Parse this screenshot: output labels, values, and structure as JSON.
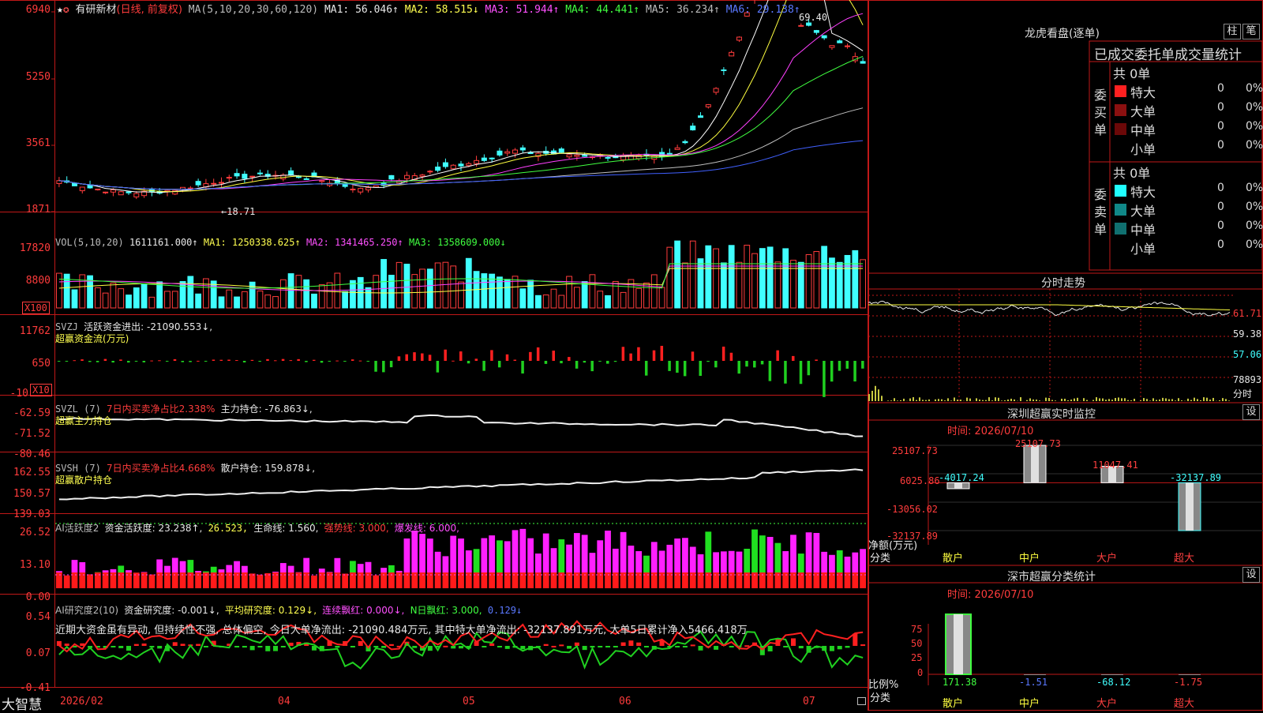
{
  "kline": {
    "title": "有研新材",
    "mode": "(日线, 前复权)",
    "ma_prefix": "MA(5,10,20,30,60,120)",
    "ma1": "MA1: 56.046↑",
    "ma2": "MA2: 58.515↓",
    "ma3": "MA3: 51.944↑",
    "ma4": "MA4: 44.441↑",
    "ma5": "MA5: 36.234↑",
    "ma6": "MA6: 29.138↑",
    "yaxis": [
      "6940",
      "5250",
      "3561",
      "1871"
    ],
    "high_label": "69.40",
    "low_label": "←18.71"
  },
  "vol": {
    "header": "VOL(5,10,20)",
    "value": "1611161.000↑",
    "ma1": "MA1: 1250338.625↑",
    "ma2": "MA2: 1341465.250↑",
    "ma3": "MA3: 1358609.000↓",
    "yaxis": [
      "17820",
      "8800"
    ],
    "unit": "X100"
  },
  "svzj": {
    "header": "SVZJ",
    "label": "活跃资金进出: -21090.553↓,",
    "sub": "超赢资金流(万元)",
    "yaxis": [
      "11762",
      "650",
      "-10"
    ],
    "unit": "X10"
  },
  "svzl": {
    "header": "SVZL (7)",
    "label1": "7日内买卖净占比2.338%",
    "label2": "主力持仓: -76.863↓,",
    "sub": "超赢主力持仓",
    "yaxis": [
      "-62.59",
      "-71.52",
      "-80.46"
    ]
  },
  "svsh": {
    "header": "SVSH (7)",
    "label1": "7日内买卖净占比4.668%",
    "label2": "散户持仓: 159.878↓,",
    "sub": "超赢散户持仓",
    "yaxis": [
      "162.55",
      "150.57",
      "139.03"
    ]
  },
  "ai1": {
    "header": "AI活跃度2",
    "l1": "资金活跃度: 23.238↑,",
    "l2": "26.523,",
    "l3": "生命线: 1.560,",
    "l4": "强势线: 3.000,",
    "l5": "爆发线: 6.000,",
    "yaxis": [
      "26.52",
      "13.10",
      "0.00"
    ]
  },
  "ai2": {
    "header": "AI研究度2(10)",
    "l1": "资金研究度: -0.001↓,",
    "l2": "平均研究度: 0.129↓,",
    "l3": "连续飘红: 0.000↓,",
    "l4": "N日飘红: 3.000,",
    "l5": "0.129↓",
    "note": "近期大资金虽有异动, 但持续性不强, 总体偏空, 今日大单净流出: -21090.484万元, 其中特大单净流出: -32137.891万元, 大单5日累计净入5466.418万",
    "yaxis": [
      "0.54",
      "0.07",
      "-0.41"
    ]
  },
  "xaxis": {
    "brand": "大智慧",
    "labels": [
      "2026/02",
      "04",
      "05",
      "06",
      "07"
    ]
  },
  "dragon": {
    "title": "龙虎看盘(逐单)",
    "btn1": "柱",
    "btn2": "笔",
    "subtitle": "已成交委托单成交量统计",
    "buy_label": "委买单",
    "sell_label": "委卖单",
    "buy_total": "共 0单",
    "sell_total": "共 0单",
    "buy_rows": [
      {
        "name": "特大",
        "n": "0",
        "p": "0%",
        "color": "#ff2020"
      },
      {
        "name": "大单",
        "n": "0",
        "p": "0%",
        "color": "#8b1010"
      },
      {
        "name": "中单",
        "n": "0",
        "p": "0%",
        "color": "#6b0808"
      },
      {
        "name": "小单",
        "n": "0",
        "p": "0%",
        "color": "#000000"
      }
    ],
    "sell_rows": [
      {
        "name": "特大",
        "n": "0",
        "p": "0%",
        "color": "#20ffff"
      },
      {
        "name": "大单",
        "n": "0",
        "p": "0%",
        "color": "#108888"
      },
      {
        "name": "中单",
        "n": "0",
        "p": "0%",
        "color": "#107070"
      },
      {
        "name": "小单",
        "n": "0",
        "p": "0%",
        "color": "#000000"
      }
    ]
  },
  "intraday": {
    "title": "分时走势",
    "ylabels": [
      "61.71",
      "59.38",
      "57.06"
    ],
    "vol_label": "78893",
    "time_label": "分时"
  },
  "szmonitor": {
    "title": "深圳超赢实时监控",
    "btn": "设",
    "time": "时间: 2026/07/10",
    "yaxis": [
      "25107.73",
      "6025.86",
      "-13056.02",
      "-32137.89"
    ],
    "ylabel1": "净额(万元)",
    "ylabel2": "分类",
    "categories": [
      "散户",
      "中户",
      "大户",
      "超大"
    ],
    "values": [
      -4017.24,
      25107.73,
      11047.41,
      -32137.89
    ],
    "value_labels": [
      "-4017.24",
      "25107.73",
      "11047.41",
      "-32137.89"
    ]
  },
  "szstat": {
    "title": "深市超赢分类统计",
    "btn": "设",
    "time": "时间: 2026/07/10",
    "yaxis": [
      "75",
      "50",
      "25",
      "0"
    ],
    "ylabel1": "比例%",
    "ylabel2": "分类",
    "categories": [
      "散户",
      "中户",
      "大户",
      "超大"
    ],
    "values": [
      171.38,
      -1.51,
      -68.12,
      -1.75
    ],
    "value_labels": [
      "171.38",
      "-1.51",
      "-68.12",
      "-1.75"
    ]
  },
  "chart_data": [
    {
      "type": "bar",
      "title": "深圳超赢实时监控",
      "ylabel": "净额(万元)",
      "categories": [
        "散户",
        "中户",
        "大户",
        "超大"
      ],
      "values": [
        -4017.24,
        25107.73,
        11047.41,
        -32137.89
      ],
      "ylim": [
        -32137.89,
        25107.73
      ]
    },
    {
      "type": "bar",
      "title": "深市超赢分类统计",
      "ylabel": "比例%",
      "categories": [
        "散户",
        "中户",
        "大户",
        "超大"
      ],
      "values": [
        171.38,
        -1.51,
        -68.12,
        -1.75
      ],
      "ylim": [
        0,
        75
      ]
    }
  ]
}
